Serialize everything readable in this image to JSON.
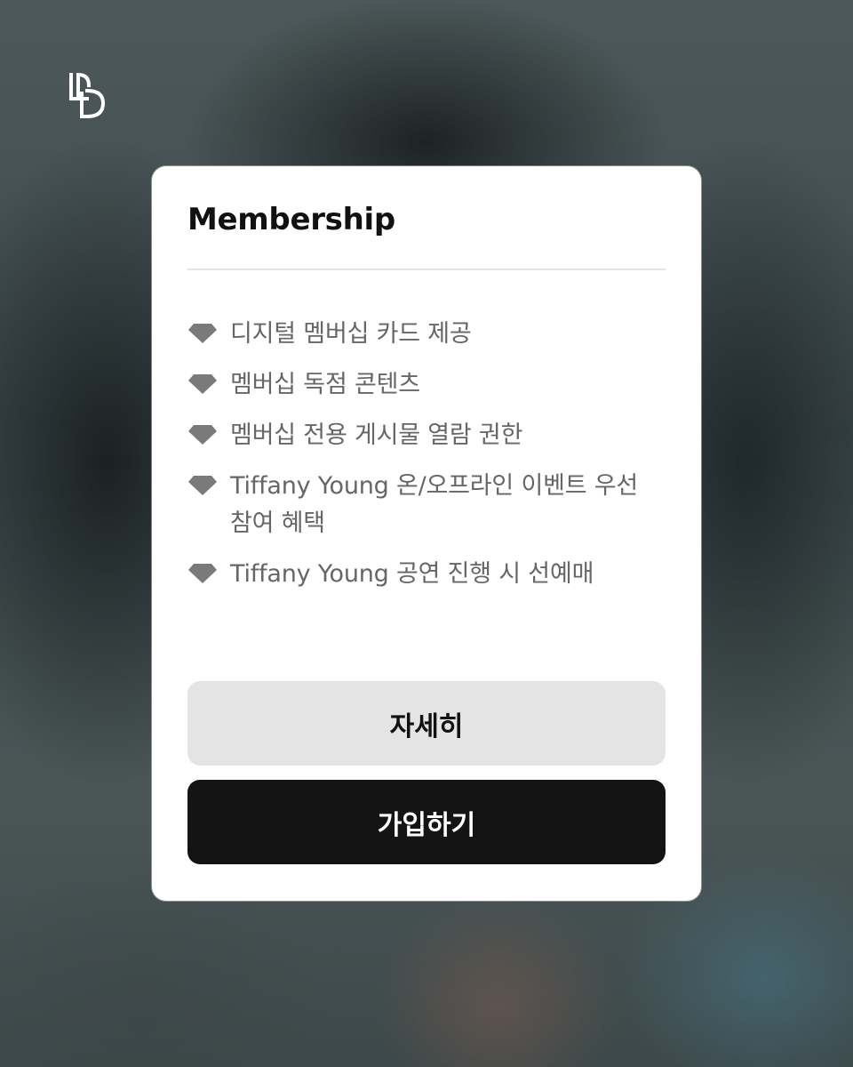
{
  "brand": {
    "logo_icon": "bd-monogram-icon"
  },
  "card": {
    "title": "Membership",
    "benefit_icon": "diamond-icon",
    "benefits": [
      "디지털 멤버십 카드 제공",
      "멤버십 독점 콘텐츠",
      "멤버십 전용 게시물 열람 권한",
      "Tiffany Young 온/오프라인 이벤트 우선 참여 혜택",
      "Tiffany Young 공연 진행 시 선예매"
    ],
    "details_button": "자세히",
    "join_button": "가입하기"
  },
  "colors": {
    "card_background": "#ffffff",
    "secondary_button": "#e4e4e4",
    "primary_button": "#141414",
    "benefit_text": "#666666",
    "icon": "#7a7a7a"
  }
}
